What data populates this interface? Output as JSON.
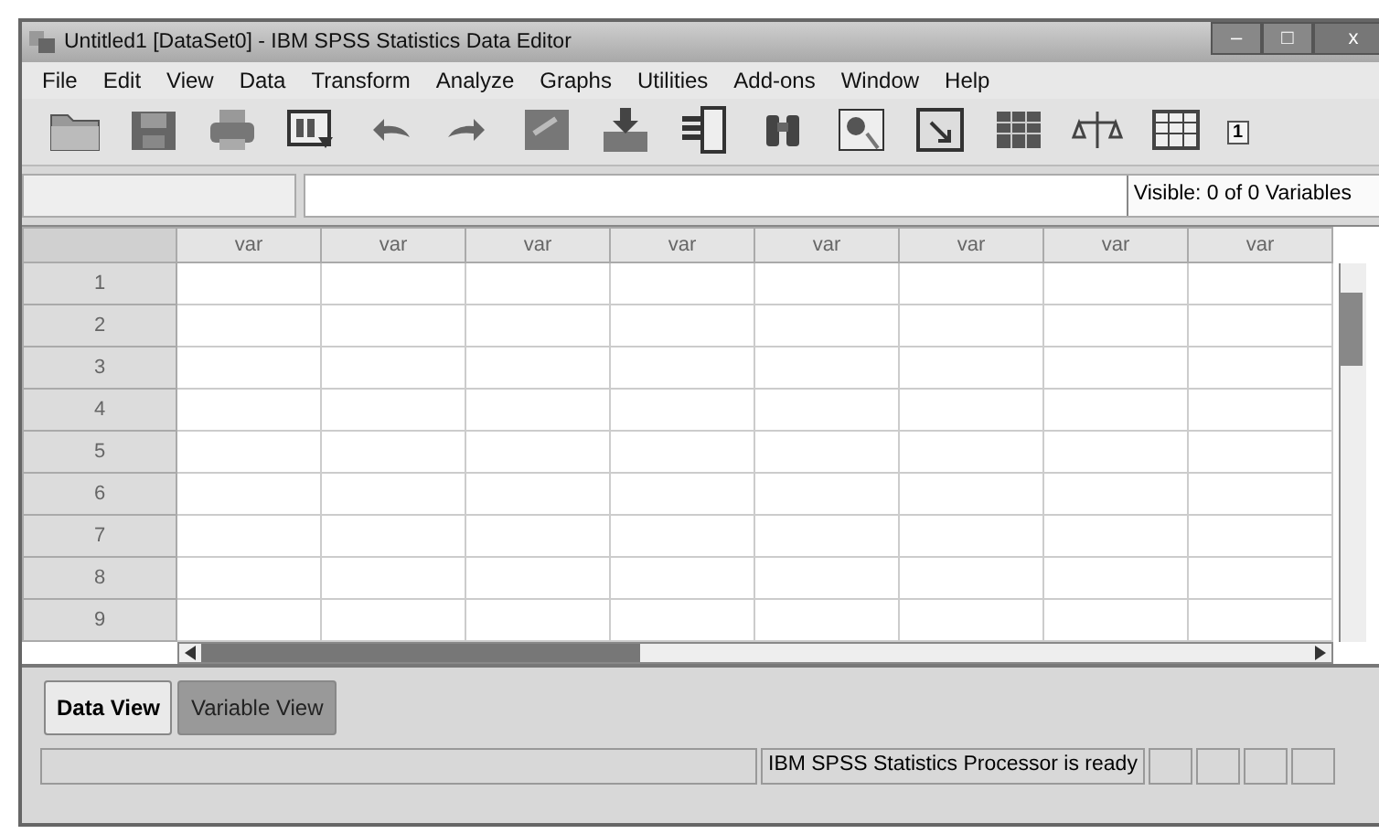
{
  "window": {
    "title": "Untitled1 [DataSet0] - IBM SPSS Statistics Data Editor",
    "controls": [
      "–",
      "□",
      "x"
    ]
  },
  "menu": [
    "File",
    "Edit",
    "View",
    "Data",
    "Transform",
    "Analyze",
    "Graphs",
    "Utilities",
    "Add-ons",
    "Window",
    "Help"
  ],
  "toolbar": {
    "badge": "1"
  },
  "cell_bar": {
    "visible": "Visible: 0 of 0 Variables"
  },
  "table": {
    "columns": [
      "var",
      "var",
      "var",
      "var",
      "var",
      "var",
      "var",
      "var"
    ],
    "rows": [
      "1",
      "2",
      "3",
      "4",
      "5",
      "6",
      "7",
      "8",
      "9"
    ]
  },
  "tabs": [
    {
      "label": "Data View",
      "selected": true
    },
    {
      "label": "Variable View",
      "selected": false
    }
  ],
  "status_bar": {
    "message": "IBM SPSS Statistics Processor is ready"
  }
}
